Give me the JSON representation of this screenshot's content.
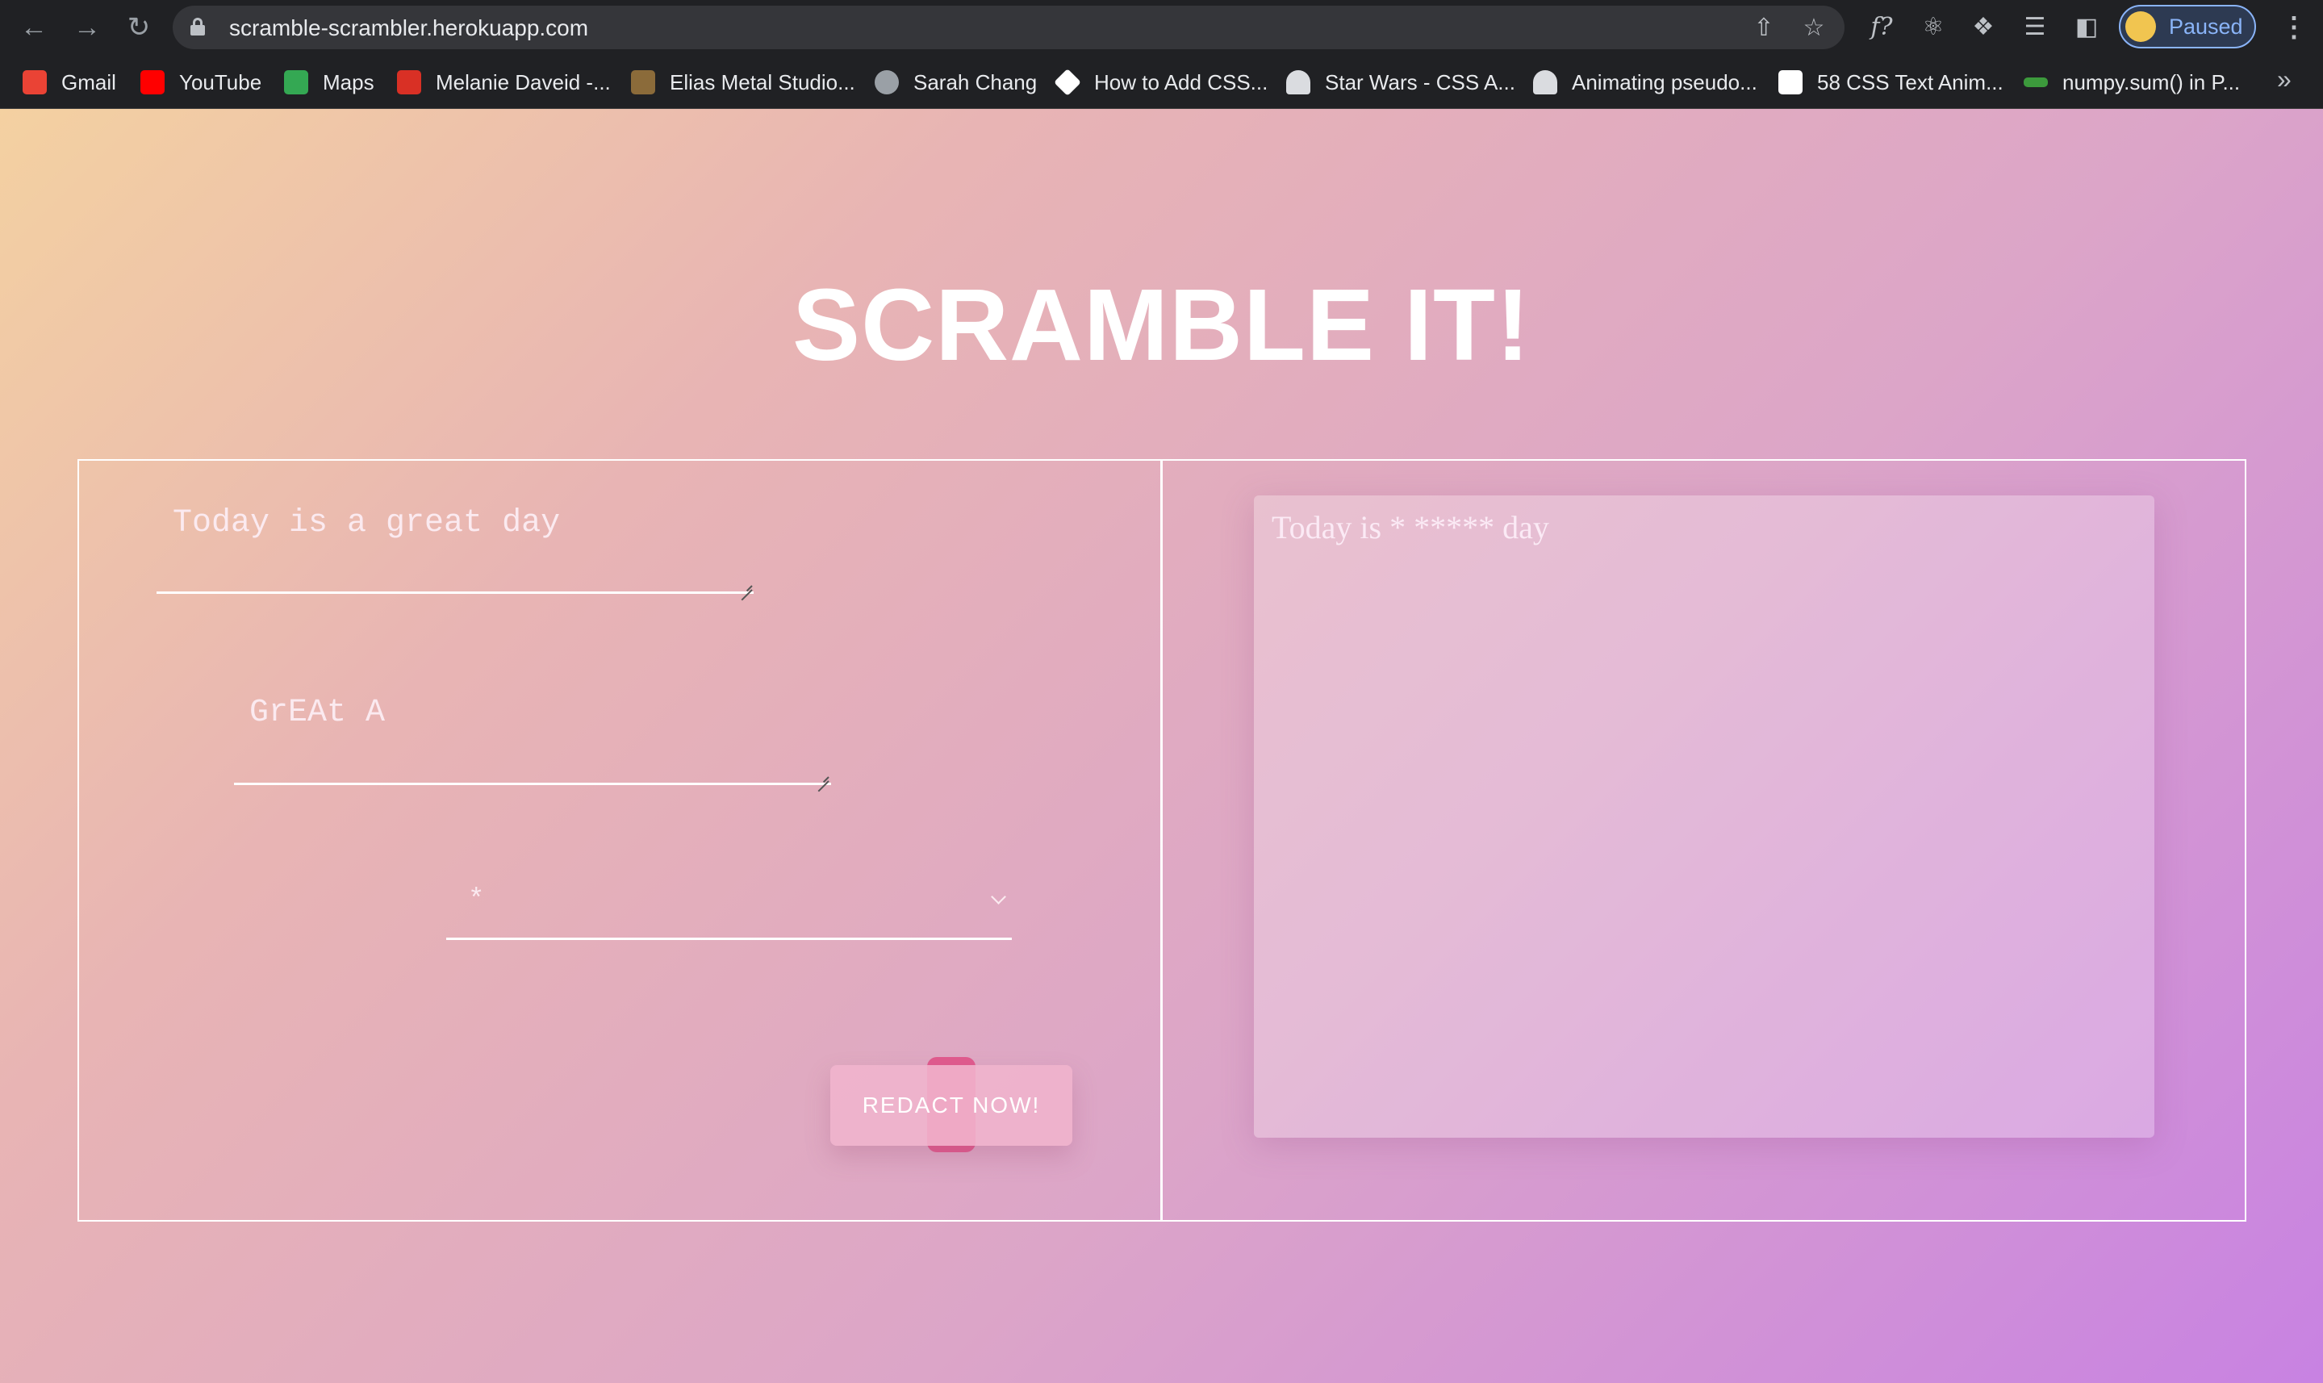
{
  "browser": {
    "url": "scramble-scrambler.herokuapp.com",
    "profile_label": "Paused",
    "bookmarks": [
      {
        "label": "Gmail",
        "color": "#ea4335"
      },
      {
        "label": "YouTube",
        "color": "#ff0000"
      },
      {
        "label": "Maps",
        "color": "#34a853"
      },
      {
        "label": "Melanie Daveid -...",
        "color": "#d93025"
      },
      {
        "label": "Elias Metal Studio...",
        "color": "#8b6b3a"
      },
      {
        "label": "Sarah Chang",
        "color": "#9aa0a6"
      },
      {
        "label": "How to Add CSS...",
        "color": "#ffffff"
      },
      {
        "label": "Star Wars - CSS A...",
        "color": "#dadce0"
      },
      {
        "label": "Animating pseudo...",
        "color": "#dadce0"
      },
      {
        "label": "58 CSS Text Anim...",
        "color": "#ffffff"
      },
      {
        "label": "numpy.sum() in P...",
        "color": "#3c9a3c"
      }
    ]
  },
  "page": {
    "title": "SCRAMBLE IT!",
    "sentence_input": "Today is a great day",
    "words_input": "GrEAt A",
    "redact_char": "*",
    "redact_button": "REDACT NOW!",
    "output": "Today is * ***** day"
  }
}
